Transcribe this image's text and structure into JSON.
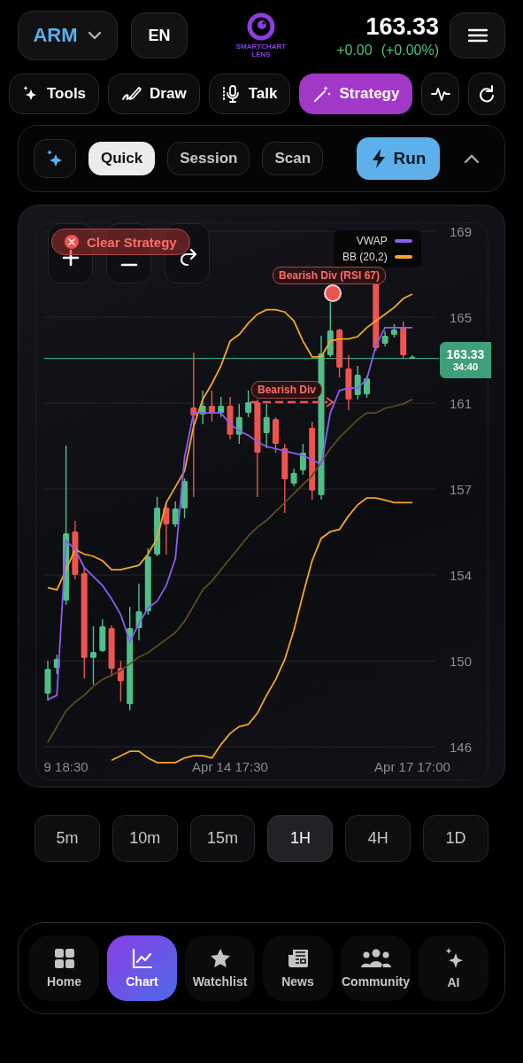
{
  "header": {
    "symbol": "ARM",
    "language": "EN",
    "logo_lines": [
      "SMARTCHART",
      "LENS"
    ],
    "price": "163.33",
    "change": "+0.00",
    "change_percent": "(+0.00%)"
  },
  "toolbar": [
    {
      "label": "Tools",
      "selected": false
    },
    {
      "label": "Draw",
      "selected": false
    },
    {
      "label": "Talk",
      "selected": false
    },
    {
      "label": "Strategy",
      "selected": true
    }
  ],
  "strategy_panel": {
    "modes": [
      {
        "label": "Quick",
        "selected": true
      },
      {
        "label": "Session",
        "selected": false
      },
      {
        "label": "Scan",
        "selected": false
      }
    ],
    "run_label": "Run",
    "expanded": true
  },
  "chart": {
    "clear_strategy_label": "Clear Strategy",
    "annotations": [
      "Bearish Div (RSI 67)",
      "Bearish Div"
    ],
    "countdown": "34:40",
    "chart_data": {
      "type": "candlestick",
      "categories": [
        null,
        null,
        "9 18:30",
        null,
        null,
        null,
        null,
        null,
        null,
        null,
        null,
        null,
        null,
        null,
        null,
        null,
        null,
        null,
        null,
        null,
        "Apr 14 17:30",
        null,
        null,
        null,
        null,
        null,
        null,
        null,
        null,
        null,
        null,
        null,
        null,
        null,
        null,
        null,
        null,
        null,
        null,
        null,
        "Apr 17 17:00"
      ],
      "ylim": [
        144.5,
        169.4
      ],
      "grid": true,
      "ref_lines": [
        {
          "axis": "y",
          "value": 163.33,
          "label": "163.33",
          "color": "#3f9f78"
        }
      ],
      "legend": "upper right",
      "ohlc": [
        [
          148.37,
          149.84,
          148.06,
          149.48
        ],
        [
          149.52,
          150.11,
          149.24,
          149.92
        ],
        [
          152.52,
          159.44,
          152.33,
          155.53
        ],
        [
          155.61,
          156.08,
          153.47,
          153.67
        ],
        [
          153.75,
          153.99,
          149.05,
          149.96
        ],
        [
          149.96,
          151.38,
          148.77,
          150.23
        ],
        [
          150.27,
          151.69,
          150.23,
          151.38
        ],
        [
          151.3,
          151.42,
          149.13,
          149.48
        ],
        [
          149.52,
          149.84,
          148.02,
          148.93
        ],
        [
          147.9,
          152.25,
          147.62,
          151.3
        ],
        [
          151.3,
          153.28,
          150.75,
          152.05
        ],
        [
          152.05,
          154.86,
          151.89,
          154.5
        ],
        [
          154.58,
          157.15,
          154.5,
          156.67
        ],
        [
          156.67,
          156.87,
          154.58,
          155.92
        ],
        [
          155.92,
          156.95,
          155.8,
          156.63
        ],
        [
          156.63,
          157.98,
          156.2,
          157.86
        ],
        [
          161.14,
          163.59,
          157.15,
          160.78
        ],
        [
          160.82,
          161.89,
          160.39,
          161.22
        ],
        [
          161.22,
          161.89,
          160.51,
          160.9
        ],
        [
          160.9,
          161.61,
          160.71,
          161.22
        ],
        [
          161.22,
          161.61,
          159.72,
          159.92
        ],
        [
          159.92,
          161.3,
          159.52,
          160.71
        ],
        [
          160.9,
          161.89,
          160.71,
          161.38
        ],
        [
          161.38,
          161.5,
          157.15,
          159.12
        ],
        [
          159.99,
          161.3,
          159.32,
          160.71
        ],
        [
          160.63,
          160.71,
          159.12,
          159.52
        ],
        [
          159.32,
          159.52,
          156.44,
          157.94
        ],
        [
          157.74,
          158.41,
          157.62,
          158.22
        ],
        [
          158.33,
          159.52,
          158.14,
          159.12
        ],
        [
          160.23,
          160.51,
          157.03,
          157.43
        ],
        [
          157.23,
          164.34,
          157.03,
          163.55
        ],
        [
          163.47,
          165.84,
          163.39,
          164.58
        ],
        [
          164.62,
          164.66,
          162.48,
          162.92
        ],
        [
          162.88,
          163.47,
          161.02,
          161.5
        ],
        [
          161.69,
          163.0,
          161.5,
          162.6
        ],
        [
          161.73,
          162.56,
          161.57,
          162.44
        ],
        [
          166.71,
          166.71,
          163.67,
          163.79
        ],
        [
          163.99,
          164.54,
          163.87,
          164.34
        ],
        [
          164.38,
          164.86,
          164.26,
          164.62
        ],
        [
          164.74,
          164.97,
          163.35,
          163.47
        ],
        [
          163.33,
          163.47,
          163.33,
          163.4
        ]
      ],
      "yticks": [
        {
          "value": 169,
          "label": "169"
        },
        {
          "value": 165.17,
          "label": "165"
        },
        {
          "value": 161.33,
          "label": "161"
        },
        {
          "value": 157.5,
          "label": "157"
        },
        {
          "value": 153.67,
          "label": "154"
        },
        {
          "value": 149.83,
          "label": "150"
        },
        {
          "value": 146,
          "label": "146"
        }
      ],
      "series": [
        {
          "name": "VWAP",
          "type": "line",
          "color": "#8b5cf6",
          "values": [
            148.1,
            148.3,
            155.2,
            154.8,
            154.0,
            153.6,
            153.2,
            152.6,
            151.9,
            150.7,
            151.5,
            152.2,
            152.5,
            153.2,
            154.4,
            158.9,
            160.9,
            160.9,
            160.9,
            160.9,
            160.4,
            160.1,
            159.9,
            159.6,
            159.4,
            159.3,
            159.2,
            159.1,
            159.0,
            158.8,
            158.6,
            160.9,
            161.9,
            162.0,
            162.0,
            162.4,
            163.9,
            164.7,
            164.7,
            164.7,
            164.7
          ]
        },
        {
          "name": "BB (20,2)",
          "type": "line",
          "color": "#f5a623",
          "values": [
            153.1,
            153.0,
            153.9,
            154.8,
            154.6,
            154.5,
            154.3,
            153.9,
            153.9,
            154.0,
            154.1,
            154.6,
            155.3,
            156.9,
            157.6,
            158.3,
            160.3,
            161.5,
            162.2,
            163.0,
            164.1,
            164.4,
            164.9,
            165.3,
            165.5,
            165.5,
            165.4,
            165.0,
            164.1,
            163.4,
            163.4,
            164.1,
            164.2,
            164.2,
            164.3,
            164.7,
            165.0,
            165.3,
            165.6,
            166.0,
            166.2
          ]
        },
        {
          "type": "line",
          "color": "#f5a623",
          "values": [
            null,
            null,
            null,
            null,
            null,
            null,
            null,
            145.4,
            145.6,
            145.8,
            145.8,
            145.5,
            145.3,
            145.3,
            145.3,
            145.5,
            145.6,
            145.6,
            145.5,
            146.1,
            146.6,
            146.9,
            147.0,
            147.5,
            148.3,
            149.0,
            149.9,
            151.2,
            152.8,
            154.3,
            155.3,
            155.6,
            155.7,
            156.3,
            156.8,
            157.1,
            157.1,
            157.0,
            156.9,
            156.9,
            156.9
          ]
        },
        {
          "type": "line",
          "color": "#5e4a22",
          "values": [
            146.2,
            146.9,
            147.6,
            148.0,
            148.3,
            148.7,
            149.0,
            149.2,
            149.4,
            149.7,
            150.0,
            150.2,
            150.5,
            150.8,
            151.1,
            151.6,
            152.3,
            153.0,
            153.4,
            153.9,
            154.4,
            154.9,
            155.4,
            155.8,
            156.1,
            156.5,
            156.9,
            157.3,
            157.7,
            158.1,
            158.7,
            159.3,
            159.8,
            160.2,
            160.6,
            160.9,
            160.9,
            161.1,
            161.2,
            161.3,
            161.5
          ]
        }
      ]
    }
  },
  "timeframes": [
    {
      "label": "5m",
      "selected": false
    },
    {
      "label": "10m",
      "selected": false
    },
    {
      "label": "15m",
      "selected": false
    },
    {
      "label": "1H",
      "selected": true
    },
    {
      "label": "4H",
      "selected": false
    },
    {
      "label": "1D",
      "selected": false
    }
  ],
  "nav": [
    {
      "label": "Home",
      "selected": false
    },
    {
      "label": "Chart",
      "selected": true
    },
    {
      "label": "Watchlist",
      "selected": false
    },
    {
      "label": "News",
      "selected": false
    },
    {
      "label": "Community",
      "selected": false
    },
    {
      "label": "AI",
      "selected": false
    }
  ]
}
